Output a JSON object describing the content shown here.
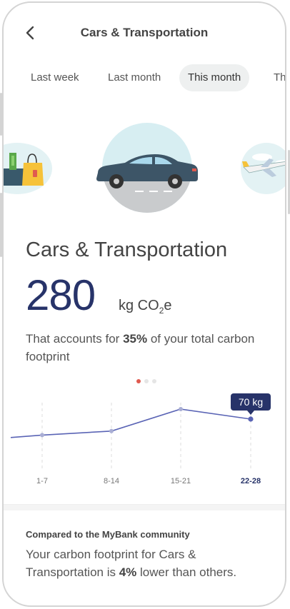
{
  "header": {
    "title": "Cars & Transportation",
    "back_icon": "chevron-left-icon"
  },
  "tabs": [
    {
      "label": "Last week",
      "active": false
    },
    {
      "label": "Last month",
      "active": false
    },
    {
      "label": "This month",
      "active": true
    },
    {
      "label": "Th",
      "active": false
    }
  ],
  "carousel": {
    "items": [
      "shopping-icon",
      "car-icon",
      "airplane-icon"
    ],
    "active_index": 1
  },
  "category": {
    "title": "Cars & Transportation",
    "amount": "280",
    "unit": "kg CO",
    "unit_sub": "2",
    "unit_suffix": "e",
    "desc_pre": "That accounts for ",
    "desc_pct": "35%",
    "desc_post": " of your total carbon footprint"
  },
  "pager": {
    "count": 3,
    "active": 0
  },
  "chart_data": {
    "type": "line",
    "categories": [
      "1-7",
      "8-14",
      "15-21",
      "22-28"
    ],
    "values": [
      57,
      59,
      70,
      65
    ],
    "tooltip": "70 kg",
    "highlight_category": "22-28",
    "color": "#5a64b5"
  },
  "comparison": {
    "title": "Compared to the MyBank community",
    "text_pre": "Your carbon footprint for Cars & Transportation is ",
    "text_pct": "4%",
    "text_post": " lower than others."
  },
  "colors": {
    "accent": "#273369",
    "line": "#5a64b5",
    "tab_active_bg": "#eef0f0",
    "pager_active": "#e05a4f",
    "icon_bg": "#e3f2f4"
  }
}
